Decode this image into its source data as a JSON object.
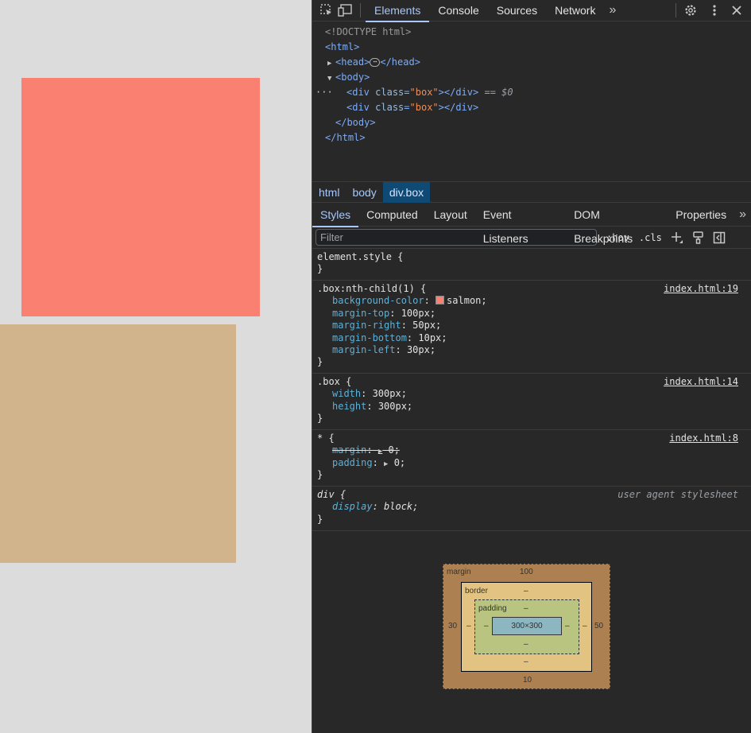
{
  "preview": {
    "box1_color": "#fa8072",
    "box2_color": "#d2b48c"
  },
  "toolbar": {
    "icons": [
      "inspect-element-icon",
      "device-toolbar-icon"
    ],
    "tabs": [
      "Elements",
      "Console",
      "Sources",
      "Network"
    ],
    "more": ">>",
    "right_icons": [
      "settings-icon",
      "kebab-menu-icon",
      "close-icon"
    ]
  },
  "dom": {
    "doctype": "<!DOCTYPE html>",
    "html_open": "<html>",
    "head_open": "<head>",
    "head_close": "</head>",
    "body_open": "<body>",
    "div_tag": "div",
    "class_attr": "class",
    "class_value": "\"box\"",
    "div_close": "</div>",
    "selected_marker": "== $0",
    "body_close": "</body>",
    "html_close": "</html>",
    "gutter": "···"
  },
  "breadcrumbs": [
    "html",
    "body",
    "div.box"
  ],
  "subtabs": [
    "Styles",
    "Computed",
    "Layout",
    "Event Listeners",
    "DOM Breakpoints",
    "Properties"
  ],
  "filter": {
    "placeholder": "Filter",
    "hov": ":hov",
    "cls": ".cls"
  },
  "rules": {
    "element_style": {
      "selector": "element.style {",
      "close": "}"
    },
    "nth": {
      "selector": ".box:nth-child(1) {",
      "source": "index.html:19",
      "props": [
        {
          "name": "background-color",
          "value": "salmon;"
        },
        {
          "name": "margin-top",
          "value": "100px;"
        },
        {
          "name": "margin-right",
          "value": "50px;"
        },
        {
          "name": "margin-bottom",
          "value": "10px;"
        },
        {
          "name": "margin-left",
          "value": "30px;"
        }
      ],
      "close": "}"
    },
    "box": {
      "selector": ".box {",
      "source": "index.html:14",
      "props": [
        {
          "name": "width",
          "value": "300px;"
        },
        {
          "name": "height",
          "value": "300px;"
        }
      ],
      "close": "}"
    },
    "star": {
      "selector": "* {",
      "source": "index.html:8",
      "props": [
        {
          "name": "margin",
          "value": "0;"
        },
        {
          "name": "padding",
          "value": "0;"
        }
      ],
      "close": "}"
    },
    "ua": {
      "selector": "div {",
      "source": "user agent stylesheet",
      "props": [
        {
          "name": "display",
          "value": "block;"
        }
      ],
      "close": "}"
    }
  },
  "box_model": {
    "margin_label": "margin",
    "border_label": "border",
    "padding_label": "padding",
    "margin_top": "100",
    "margin_right": "50",
    "margin_bottom": "10",
    "margin_left": "30",
    "border_top": "–",
    "border_right": "–",
    "border_bottom": "–",
    "border_left": "–",
    "padding_top": "–",
    "padding_right": "–",
    "padding_bottom": "–",
    "padding_left": "–",
    "content": "300×300",
    "colors": {
      "margin": "#ad8052",
      "border": "#e3c381",
      "padding": "#b8c47f",
      "content": "#8cb6c0"
    }
  }
}
